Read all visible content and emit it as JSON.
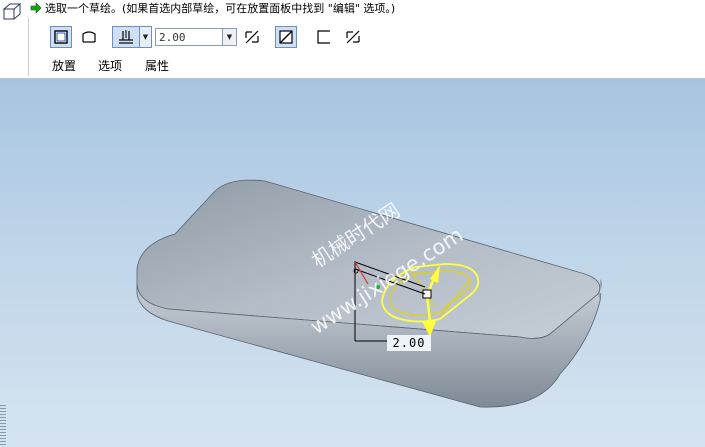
{
  "prompt": {
    "text": "选取一个草绘。(如果首选内部草绘，可在放置面板中找到 \"编辑\" 选项。)"
  },
  "dashboard": {
    "depth_value": "2.00",
    "tabs": [
      {
        "label": "放置"
      },
      {
        "label": "选项"
      },
      {
        "label": "属性"
      }
    ]
  },
  "viewport": {
    "dimension_value": "2.00",
    "watermark": {
      "line1": "机械时代网",
      "line2": "www.jixiege.com"
    }
  },
  "colors": {
    "highlight": "#ffff3c",
    "background_top": "#a7c5e0",
    "background_bottom": "#d6e4f0",
    "model_face": "#a9b4c0"
  }
}
